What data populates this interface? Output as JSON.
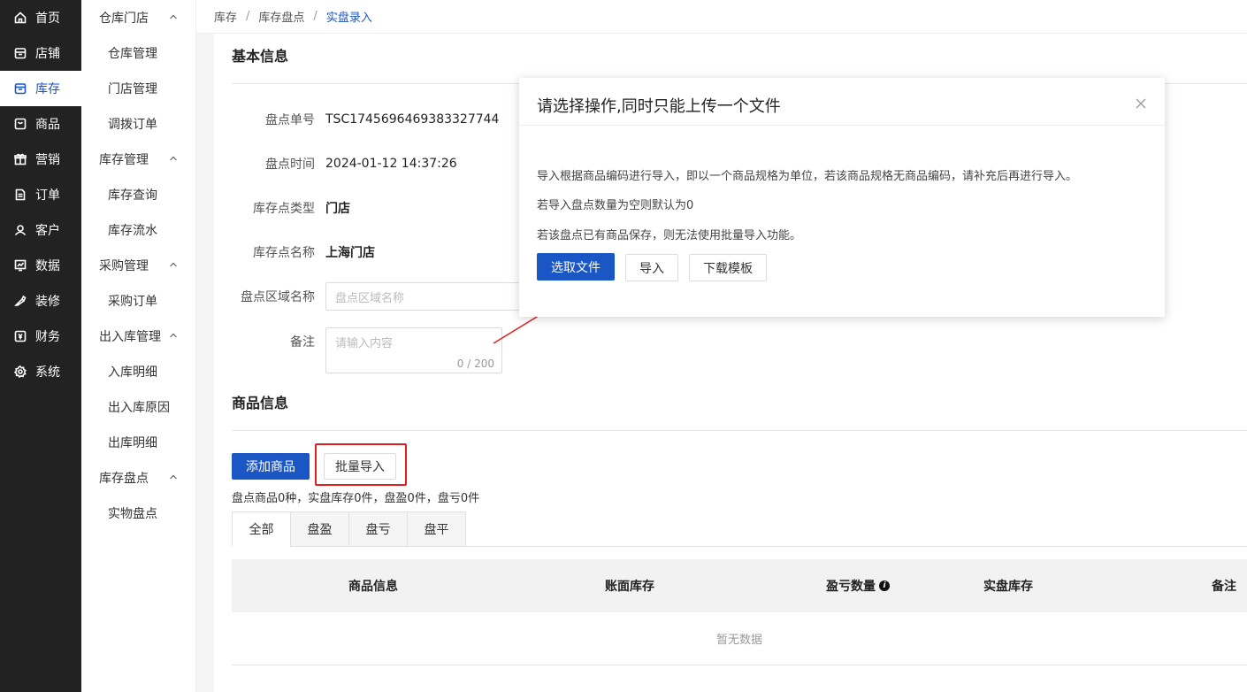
{
  "nav": [
    {
      "label": "首页",
      "icon": "home-icon"
    },
    {
      "label": "店铺",
      "icon": "store-icon"
    },
    {
      "label": "库存",
      "icon": "box-icon"
    },
    {
      "label": "商品",
      "icon": "goods-icon"
    },
    {
      "label": "营销",
      "icon": "gift-icon"
    },
    {
      "label": "订单",
      "icon": "order-icon"
    },
    {
      "label": "客户",
      "icon": "customer-icon"
    },
    {
      "label": "数据",
      "icon": "chart-icon"
    },
    {
      "label": "装修",
      "icon": "decorate-icon"
    },
    {
      "label": "财务",
      "icon": "finance-icon"
    },
    {
      "label": "系统",
      "icon": "gear-icon"
    }
  ],
  "submenu": {
    "g1": "仓库门店",
    "g1_items": [
      "仓库管理",
      "门店管理",
      "调拨订单"
    ],
    "g2": "库存管理",
    "g2_items": [
      "库存查询",
      "库存流水"
    ],
    "g3": "采购管理",
    "g3_items": [
      "采购订单"
    ],
    "g4": "出入库管理",
    "g4_items": [
      "入库明细",
      "出入库原因",
      "出库明细"
    ],
    "g5": "库存盘点",
    "g5_items": [
      "实物盘点"
    ]
  },
  "breadcrumb": {
    "a": "库存",
    "b": "库存盘点",
    "c": "实盘录入",
    "sep": "/"
  },
  "basic": {
    "title": "基本信息",
    "no_label": "盘点单号",
    "no_value": "TSC1745696469383327744",
    "time_label": "盘点时间",
    "time_value": "2024-01-12 14:37:26",
    "type_label": "库存点类型",
    "type_value": "门店",
    "name_label": "库存点名称",
    "name_value": "上海门店",
    "area_label": "盘点区域名称",
    "area_placeholder": "盘点区域名称",
    "remark_label": "备注",
    "remark_placeholder": "请输入内容",
    "remark_count": "0 / 200"
  },
  "goods": {
    "title": "商品信息",
    "add_btn": "添加商品",
    "import_btn": "批量导入",
    "summary": "盘点商品0种，实盘库存0件，盘盈0件，盘亏0件",
    "tabs": [
      "全部",
      "盘盈",
      "盘亏",
      "盘平"
    ],
    "columns": {
      "c1": "商品信息",
      "c2": "账面库存",
      "c3": "盈亏数量",
      "c4": "实盘库存",
      "c5": "备注"
    },
    "empty": "暂无数据"
  },
  "modal": {
    "title": "请选择操作,同时只能上传一个文件",
    "line1": "导入根据商品编码进行导入，即以一个商品规格为单位，若该商品规格无商品编码，请补充后再进行导入。",
    "line2": "若导入盘点数量为空则默认为0",
    "line3": "若该盘点已有商品保存，则无法使用批量导入功能。",
    "choose_btn": "选取文件",
    "import_btn": "导入",
    "template_btn": "下载模板"
  },
  "colors": {
    "accent": "#1a56c4",
    "nav_bg": "#222222",
    "highlight": "#e02020"
  }
}
